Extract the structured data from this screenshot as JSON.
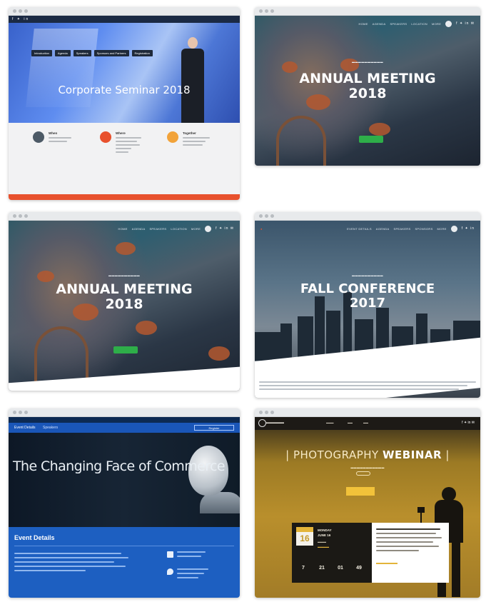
{
  "windows": [
    {
      "id": "corporate-seminar",
      "title": "Corporate Seminar 2018",
      "tabs": [
        "Introduction",
        "Agenda",
        "Speakers",
        "Sponsors and Partners",
        "Registration"
      ],
      "features": [
        {
          "title": "When",
          "icon": "clock-icon",
          "color": "#4d5a66"
        },
        {
          "title": "Where",
          "icon": "location-icon",
          "color": "#e8512d"
        },
        {
          "title": "Together",
          "icon": "people-icon",
          "color": "#f2a33a"
        }
      ]
    },
    {
      "id": "annual-meeting-a",
      "title_line1": "ANNUAL MEETING",
      "title_line2": "2018"
    },
    {
      "id": "annual-meeting-b",
      "title_line1": "ANNUAL MEETING",
      "title_line2": "2018"
    },
    {
      "id": "fall-conference",
      "title_line1": "FALL CONFERENCE",
      "title_line2": "2017"
    },
    {
      "id": "commerce",
      "nav_items": [
        "Event Details",
        "Speakers"
      ],
      "register_label": "Register",
      "title": "The Changing Face of Commerce",
      "details_heading": "Event Details"
    },
    {
      "id": "photography-webinar",
      "title_light": "PHOTOGRAPHY",
      "title_bold": "WEBINAR",
      "date_day": "16",
      "date_line1": "MONDAY",
      "date_line2": "JUNE 16",
      "countdown": [
        {
          "value": "7"
        },
        {
          "value": "21"
        },
        {
          "value": "01"
        },
        {
          "value": "49"
        }
      ]
    }
  ],
  "colors": {
    "orange_accent": "#e8512d",
    "green_button": "#2eae49",
    "commerce_blue": "#1d5fc1",
    "webinar_gold": "#b98f2c"
  }
}
